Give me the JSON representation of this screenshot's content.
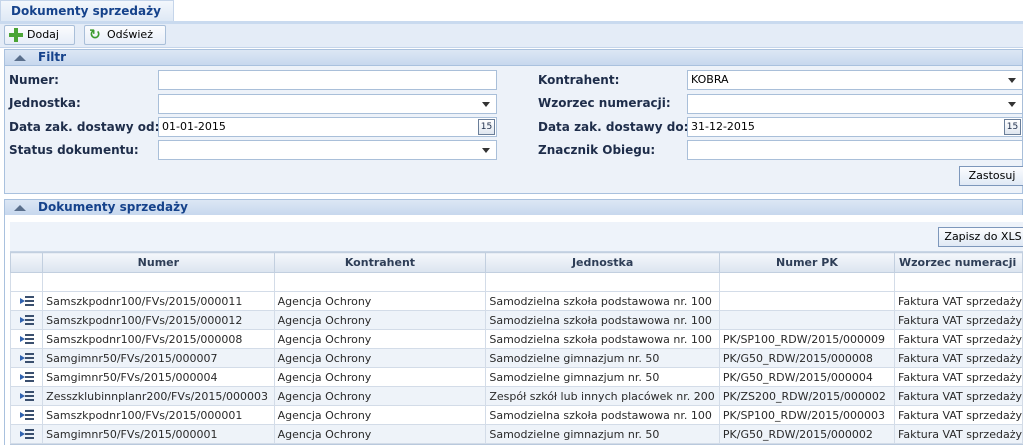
{
  "tab": {
    "title": "Dokumenty sprzedaży"
  },
  "toolbar": {
    "add_label": "Dodaj",
    "refresh_label": "Odśwież"
  },
  "filter": {
    "title": "Filtr",
    "numer_label": "Numer:",
    "numer_value": "",
    "jednostka_label": "Jednostka:",
    "jednostka_value": "",
    "data_od_label": "Data zak. dostawy od:",
    "data_od_value": "01-01-2015",
    "status_label": "Status dokumentu:",
    "status_value": "",
    "kontrahent_label": "Kontrahent:",
    "kontrahent_value": "KOBRA",
    "wzorzec_label": "Wzorzec numeracji:",
    "wzorzec_value": "",
    "data_do_label": "Data zak. dostawy do:",
    "data_do_value": "31-12-2015",
    "znacznik_label": "Znacznik Obiegu:",
    "znacznik_value": "",
    "calendar_glyph": "15",
    "apply_label": "Zastosuj"
  },
  "grid": {
    "title": "Dokumenty sprzedaży",
    "export_label": "Zapisz do XLS",
    "columns": [
      "Numer",
      "Kontrahent",
      "Jednostka",
      "Numer PK",
      "Wzorzec numeracji"
    ],
    "rows": [
      [
        "Samszkpodnr100/FVs/2015/000011",
        "Agencja Ochrony",
        "Samodzielna szkoła podstawowa nr. 100",
        "",
        "Faktura VAT sprzedaży"
      ],
      [
        "Samszkpodnr100/FVs/2015/000012",
        "Agencja Ochrony",
        "Samodzielna szkoła podstawowa nr. 100",
        "",
        "Faktura VAT sprzedaży"
      ],
      [
        "Samszkpodnr100/FVs/2015/000008",
        "Agencja Ochrony",
        "Samodzielna szkoła podstawowa nr. 100",
        "PK/SP100_RDW/2015/000009",
        "Faktura VAT sprzedaży"
      ],
      [
        "Samgimnr50/FVs/2015/000007",
        "Agencja Ochrony",
        "Samodzielne gimnazjum nr. 50",
        "PK/G50_RDW/2015/000008",
        "Faktura VAT sprzedaży"
      ],
      [
        "Samgimnr50/FVs/2015/000004",
        "Agencja Ochrony",
        "Samodzielne gimnazjum nr. 50",
        "PK/G50_RDW/2015/000004",
        "Faktura VAT sprzedaży"
      ],
      [
        "Zesszklubinnplanr200/FVs/2015/000003",
        "Agencja Ochrony",
        "Zespół szkół lub innych placówek nr. 200",
        "PK/ZS200_RDW/2015/000002",
        "Faktura VAT sprzedaży"
      ],
      [
        "Samszkpodnr100/FVs/2015/000001",
        "Agencja Ochrony",
        "Samodzielna szkoła podstawowa nr. 100",
        "PK/SP100_RDW/2015/000003",
        "Faktura VAT sprzedaży"
      ],
      [
        "Samgimnr50/FVs/2015/000001",
        "Agencja Ochrony",
        "Samodzielne gimnazjum nr. 50",
        "PK/G50_RDW/2015/000002",
        "Faktura VAT sprzedaży"
      ]
    ]
  }
}
